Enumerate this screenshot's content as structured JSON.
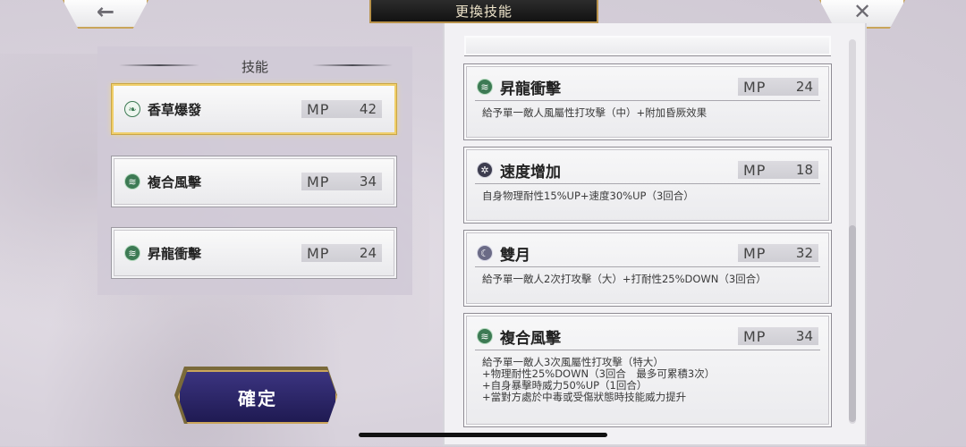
{
  "header": {
    "title": "更換技能",
    "back_glyph": "←",
    "close_glyph": "✕"
  },
  "left_panel": {
    "heading": "技能",
    "slots": [
      {
        "name": "香草爆發",
        "mp_label": "MP",
        "mp": "42",
        "icon": "grass-leaf-icon",
        "selected": true
      },
      {
        "name": "複合風擊",
        "mp_label": "MP",
        "mp": "34",
        "icon": "wind-icon",
        "selected": false
      },
      {
        "name": "昇龍衝擊",
        "mp_label": "MP",
        "mp": "24",
        "icon": "wind-icon",
        "selected": false
      }
    ]
  },
  "confirm": {
    "label": "確定"
  },
  "skill_list": [
    {
      "name": "昇龍衝擊",
      "mp_label": "MP",
      "mp": "24",
      "icon": "wind-icon",
      "desc": "給予單一敵人風屬性打攻擊（中）+附加昏厥效果"
    },
    {
      "name": "速度增加",
      "mp_label": "MP",
      "mp": "18",
      "icon": "speed-burst-icon",
      "desc": "自身物理耐性15%UP+速度30%UP（3回合）"
    },
    {
      "name": "雙月",
      "mp_label": "MP",
      "mp": "32",
      "icon": "crescent-moon-icon",
      "desc": "給予單一敵人2次打攻擊（大）+打耐性25%DOWN（3回合）"
    },
    {
      "name": "複合風擊",
      "mp_label": "MP",
      "mp": "34",
      "icon": "wind-icon",
      "desc": "給予單一敵人3次風屬性打攻擊（特大）\n+物理耐性25%DOWN（3回合　最多可累積3次）\n+自身暴擊時威力50%UP（1回合）\n+當對方處於中毒或受傷狀態時技能威力提升"
    }
  ],
  "colors": {
    "accent_gold": "#c9a55a",
    "wind_green": "#3d7a54",
    "confirm_purple": "#2d2768"
  }
}
